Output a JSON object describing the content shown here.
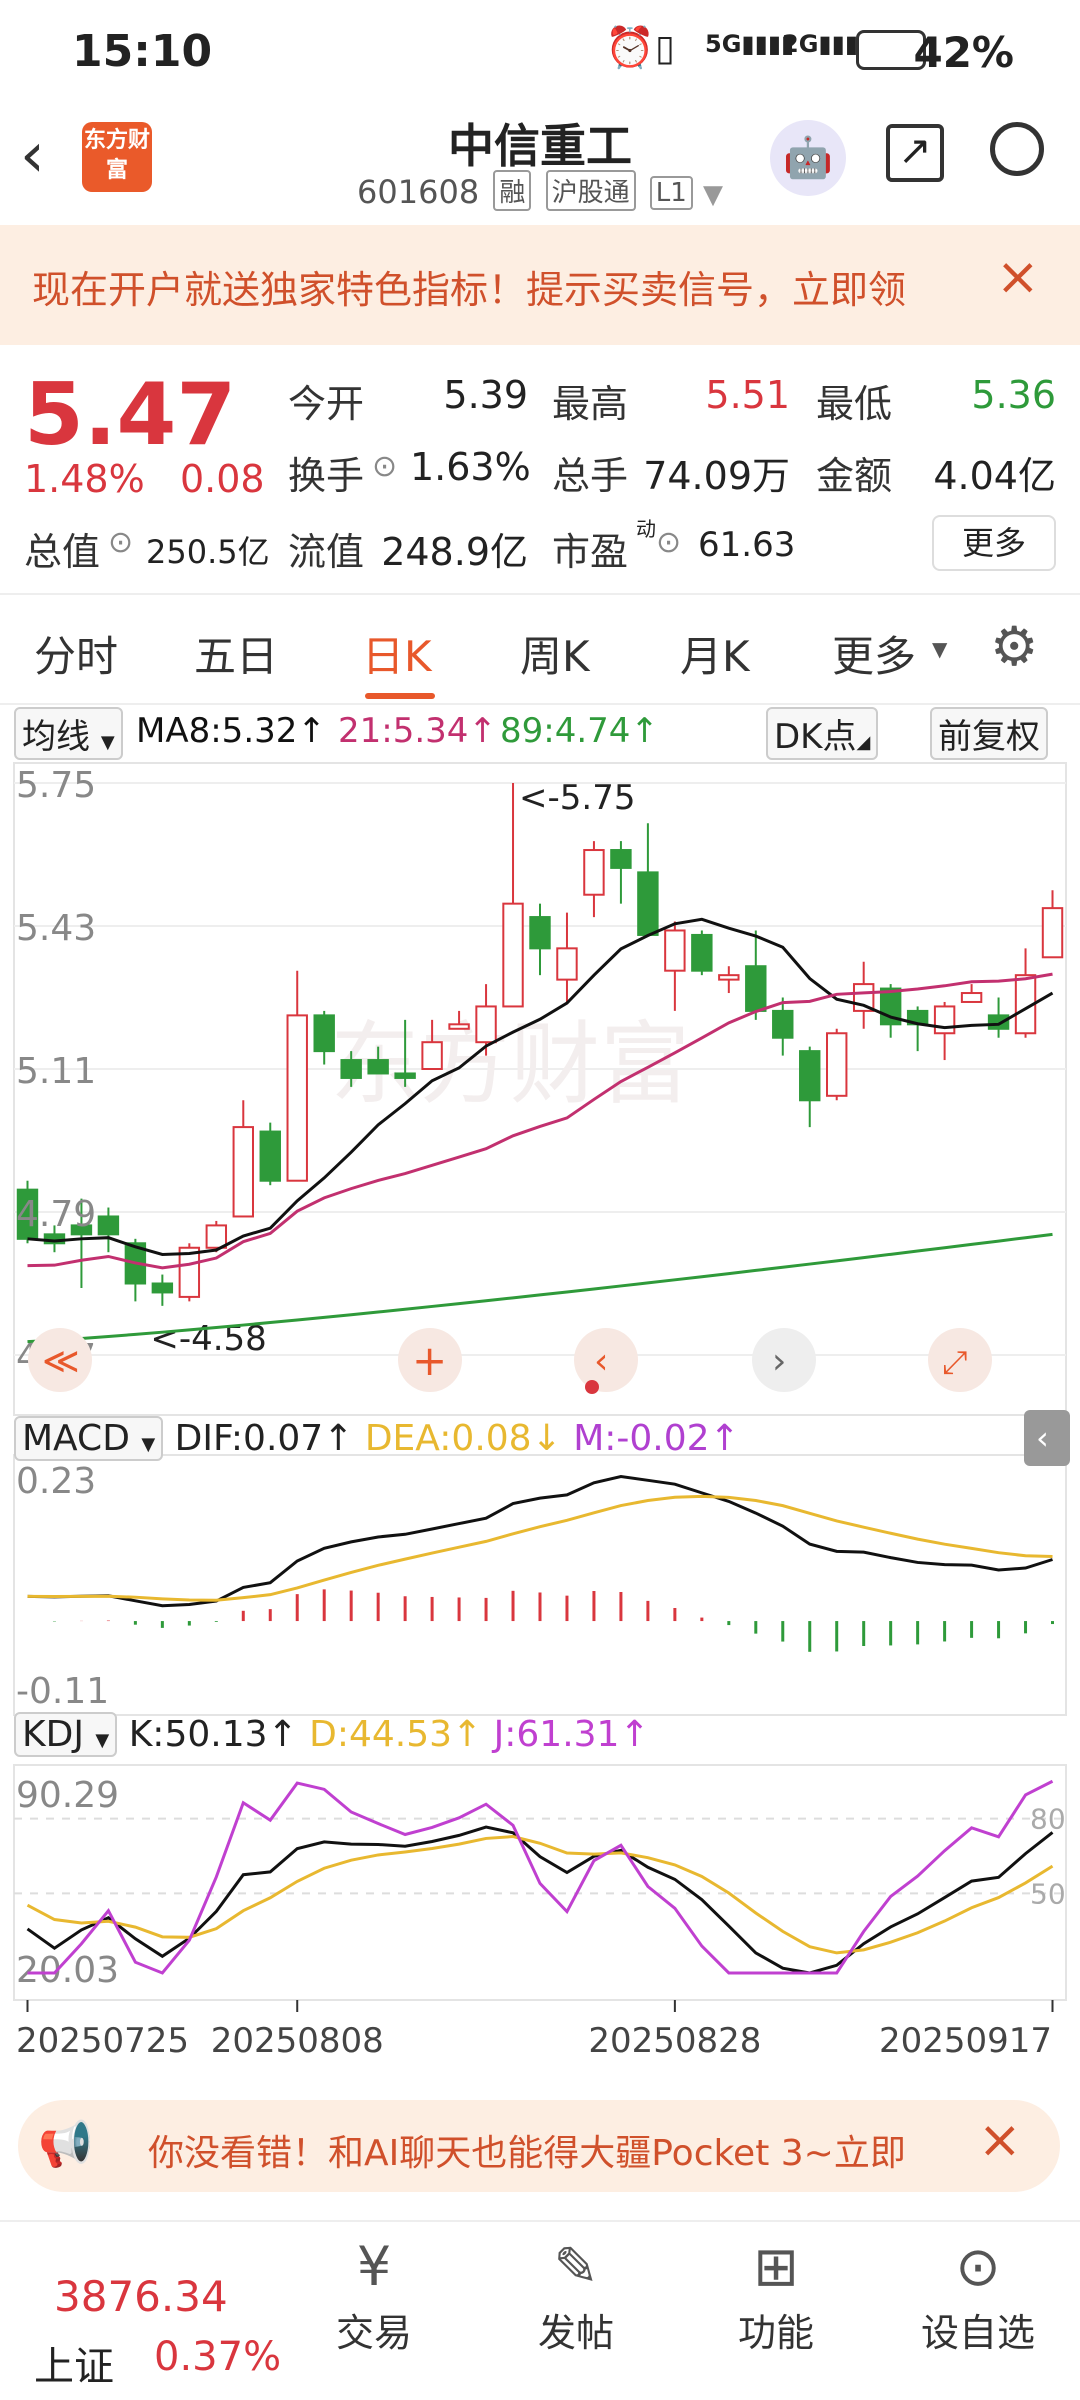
{
  "status_bar": {
    "time": "15:10",
    "network": "5G 2G",
    "battery": "42%"
  },
  "header": {
    "stock_name": "中信重工",
    "stock_code": "601608",
    "tags": [
      "融",
      "沪股通",
      "L1"
    ],
    "logo_text": "东方财富"
  },
  "banner": {
    "text": "现在开户就送独家特色指标！提示买卖信号，立即领"
  },
  "quote": {
    "price": "5.47",
    "change_pct": "1.48%",
    "change": "0.08",
    "open_label": "今开",
    "open": "5.39",
    "high_label": "最高",
    "high": "5.51",
    "low_label": "最低",
    "low": "5.36",
    "turnover_label": "换手",
    "turnover": "1.63%",
    "volume_label": "总手",
    "volume": "74.09万",
    "amount_label": "金额",
    "amount": "4.04亿",
    "mcap_label": "总值",
    "mcap": "250.5亿",
    "float_label": "流值",
    "float": "248.9亿",
    "pe_label": "市盈",
    "pe_sup": "动",
    "pe": "61.63",
    "more_label": "更多"
  },
  "tabs": [
    "分时",
    "五日",
    "日K",
    "周K",
    "月K",
    "更多"
  ],
  "active_tab": "日K",
  "ma_bar": {
    "selector": "均线",
    "ma8": "MA8:5.32↑",
    "ma21": "21:5.34↑",
    "ma89": "89:4.74↑",
    "dk_button": "DK点",
    "adjust_button": "前复权"
  },
  "colors": {
    "up": "#d9363e",
    "down": "#2e9a3a",
    "accent": "#e8582b",
    "ma8": "#111111",
    "ma21": "#c2306f",
    "ma89": "#2f9a3a",
    "dea": "#e8b830",
    "m": "#b040d0",
    "kdj_j": "#c040d0"
  },
  "chart_data": [
    {
      "type": "candlestick",
      "title": "日K",
      "y_ticks": [
        "5.75",
        "5.43",
        "5.11",
        "4.79",
        "4.47"
      ],
      "ylim": [
        4.47,
        5.75
      ],
      "annotations": {
        "max": "<-5.75",
        "min": "<-4.58"
      },
      "x_ticks": [
        "20250725",
        "20250808",
        "20250828",
        "20250917"
      ],
      "candles": [
        [
          4.84,
          4.73,
          4.86,
          4.72
        ],
        [
          4.74,
          4.72,
          4.76,
          4.7
        ],
        [
          4.76,
          4.74,
          4.82,
          4.62
        ],
        [
          4.78,
          4.74,
          4.8,
          4.7
        ],
        [
          4.72,
          4.63,
          4.73,
          4.59
        ],
        [
          4.63,
          4.61,
          4.65,
          4.58
        ],
        [
          4.6,
          4.71,
          4.72,
          4.59
        ],
        [
          4.71,
          4.76,
          4.77,
          4.7
        ],
        [
          4.78,
          4.98,
          5.04,
          4.78
        ],
        [
          4.97,
          4.86,
          4.99,
          4.85
        ],
        [
          4.86,
          5.23,
          5.33,
          4.86
        ],
        [
          5.23,
          5.15,
          5.24,
          5.12
        ],
        [
          5.13,
          5.09,
          5.15,
          5.07
        ],
        [
          5.13,
          5.1,
          5.16,
          5.1
        ],
        [
          5.1,
          5.09,
          5.22,
          5.07
        ],
        [
          5.11,
          5.17,
          5.22,
          5.11
        ],
        [
          5.2,
          5.21,
          5.24,
          5.2
        ],
        [
          5.17,
          5.25,
          5.3,
          5.14
        ],
        [
          5.25,
          5.48,
          5.75,
          5.25
        ],
        [
          5.45,
          5.38,
          5.48,
          5.32
        ],
        [
          5.31,
          5.38,
          5.46,
          5.26
        ],
        [
          5.5,
          5.6,
          5.62,
          5.45
        ],
        [
          5.6,
          5.56,
          5.62,
          5.48
        ],
        [
          5.55,
          5.41,
          5.66,
          5.41
        ],
        [
          5.33,
          5.42,
          5.44,
          5.24
        ],
        [
          5.41,
          5.33,
          5.42,
          5.32
        ],
        [
          5.31,
          5.32,
          5.34,
          5.28
        ],
        [
          5.34,
          5.24,
          5.42,
          5.22
        ],
        [
          5.24,
          5.18,
          5.27,
          5.14
        ],
        [
          5.15,
          5.04,
          5.16,
          4.98
        ],
        [
          5.05,
          5.19,
          5.2,
          5.04
        ],
        [
          5.24,
          5.3,
          5.35,
          5.2
        ],
        [
          5.29,
          5.21,
          5.3,
          5.18
        ],
        [
          5.24,
          5.21,
          5.25,
          5.15
        ],
        [
          5.19,
          5.25,
          5.26,
          5.13
        ],
        [
          5.26,
          5.28,
          5.3,
          5.26
        ],
        [
          5.23,
          5.2,
          5.27,
          5.18
        ],
        [
          5.19,
          5.32,
          5.38,
          5.18
        ],
        [
          5.36,
          5.47,
          5.51,
          5.36
        ]
      ],
      "series": [
        {
          "name": "MA8"
        },
        {
          "name": "21"
        },
        {
          "name": "89"
        }
      ]
    },
    {
      "type": "macd",
      "labels": {
        "selector": "MACD",
        "dif": "DIF:0.07↑",
        "dea": "DEA:0.08↓",
        "m": "M:-0.02↑"
      },
      "y_ticks": [
        "0.23",
        "-0.11"
      ],
      "ylim": [
        -0.11,
        0.23
      ]
    },
    {
      "type": "kdj",
      "labels": {
        "selector": "KDJ",
        "k": "K:50.13↑",
        "d": "D:44.53↑",
        "j": "J:61.31↑"
      },
      "y_ticks": [
        "90.29",
        "20.03"
      ],
      "ref_ticks": [
        "80",
        "50"
      ],
      "ylim": [
        20.03,
        90.29
      ]
    }
  ],
  "ad_banner": {
    "text": "你没看错！和AI聊天也能得大疆Pocket 3~立即"
  },
  "bottom_nav": {
    "index_value": "3876.34",
    "index_name": "上证",
    "index_change": "0.37%",
    "items": [
      "交易",
      "发帖",
      "功能",
      "设自选"
    ]
  }
}
